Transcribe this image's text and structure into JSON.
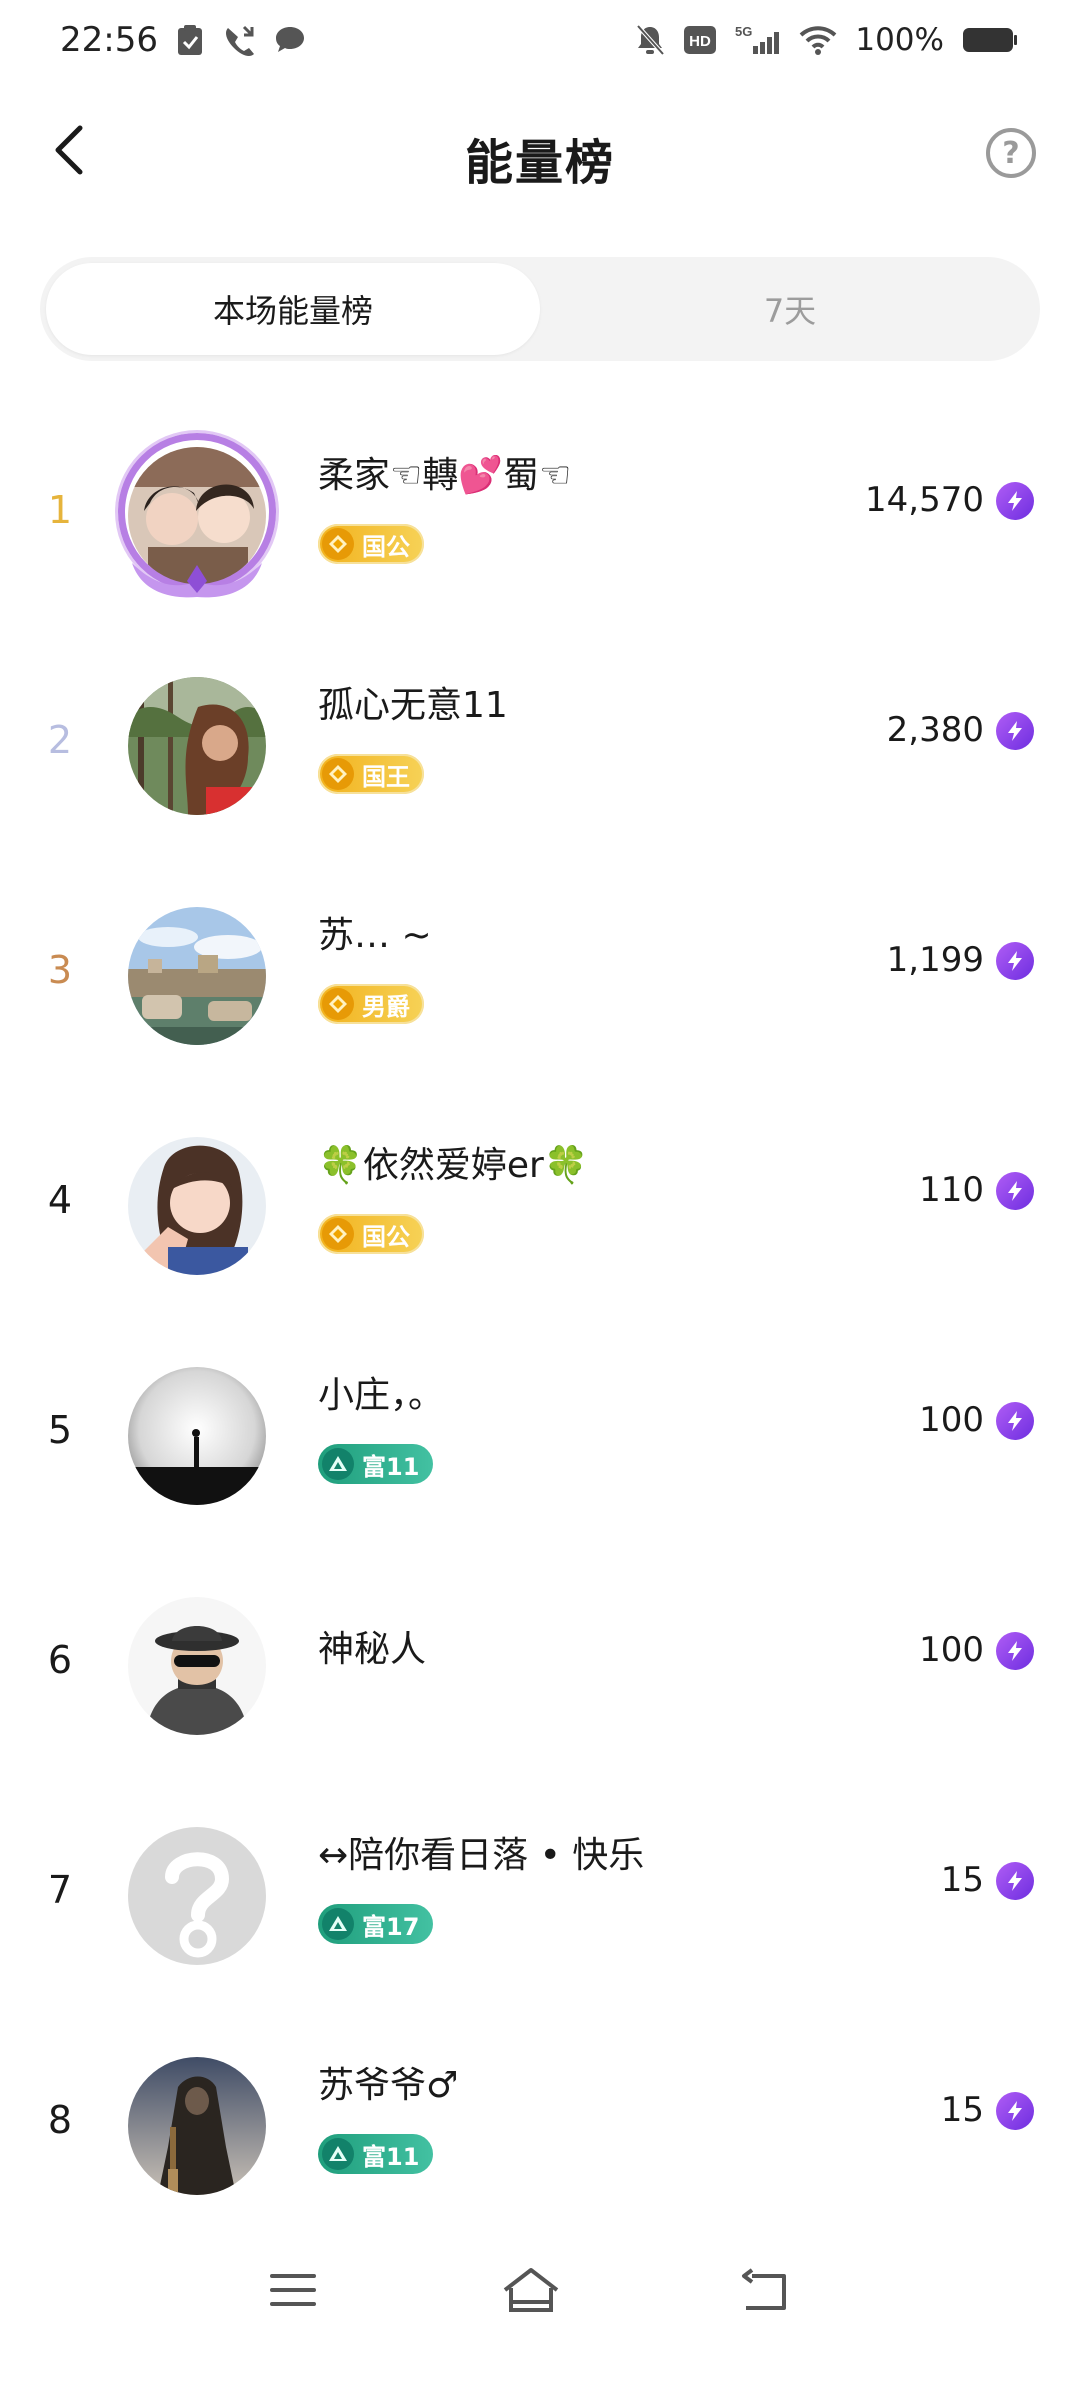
{
  "status_bar": {
    "time": "22:56",
    "battery_text": "100%",
    "signal_label": "5G",
    "hd_label": "HD"
  },
  "header": {
    "title": "能量榜",
    "help_symbol": "?"
  },
  "tabs": [
    {
      "label": "本场能量榜",
      "active": true
    },
    {
      "label": "7天",
      "active": false
    }
  ],
  "rank_colors": {
    "1": "#e6b43c",
    "2": "#b7bde0",
    "3": "#c98b52",
    "default": "#1a1a1a"
  },
  "ranking": [
    {
      "rank": "1",
      "name": "柔家☜轉💕蜀☜",
      "badge": "国公",
      "badge_type": "gold",
      "score": "14,570",
      "avatar": "photo-couple"
    },
    {
      "rank": "2",
      "name": "孤心无意11",
      "badge": "国王",
      "badge_type": "gold",
      "score": "2,380",
      "avatar": "photo-outdoor"
    },
    {
      "rank": "3",
      "name": "苏… ~",
      "badge": "男爵",
      "badge_type": "gold",
      "score": "1,199",
      "avatar": "photo-landscape"
    },
    {
      "rank": "4",
      "name": "🍀依然爱婷er🍀",
      "badge": "国公",
      "badge_type": "gold",
      "score": "110",
      "avatar": "photo-woman"
    },
    {
      "rank": "5",
      "name": "小庄，。",
      "badge": "富11",
      "badge_type": "green",
      "score": "100",
      "avatar": "photo-silhouette"
    },
    {
      "rank": "6",
      "name": "神秘人",
      "badge": "",
      "badge_type": "none",
      "score": "100",
      "avatar": "mystery-man"
    },
    {
      "rank": "7",
      "name": "↔陪你看日落 • 快乐",
      "badge": "富17",
      "badge_type": "green",
      "score": "15",
      "avatar": "placeholder-question"
    },
    {
      "rank": "8",
      "name": "苏爷爷♂",
      "badge": "富11",
      "badge_type": "green",
      "score": "15",
      "avatar": "photo-figure"
    }
  ]
}
